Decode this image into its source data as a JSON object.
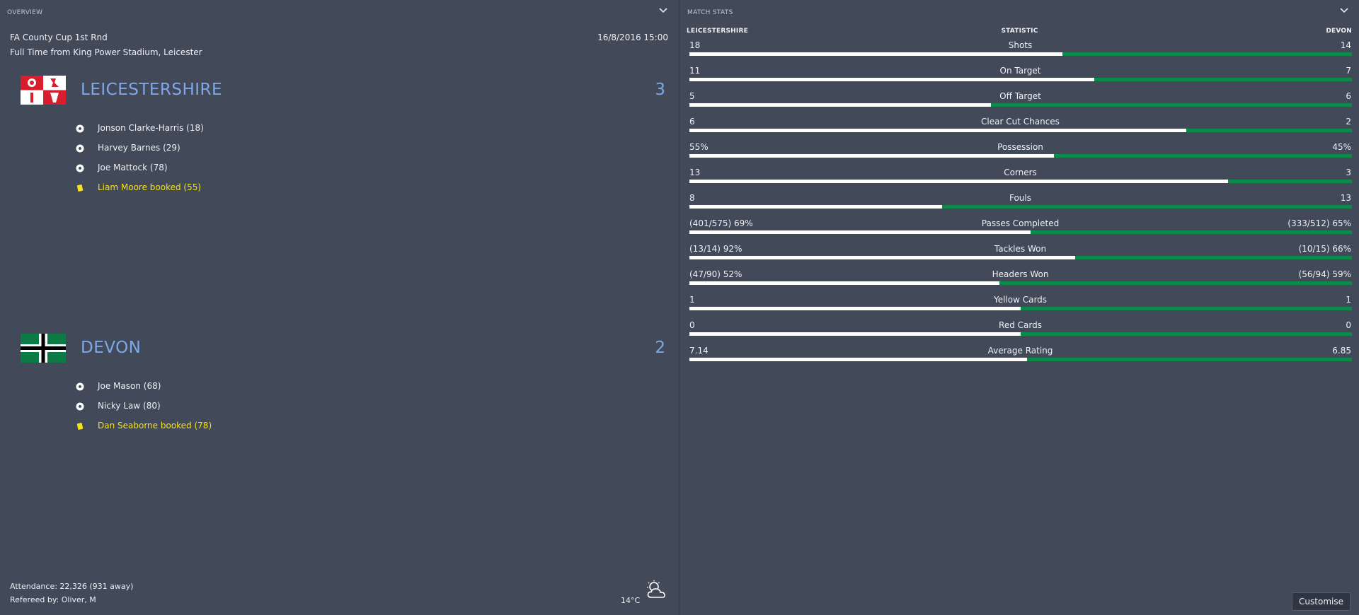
{
  "overview": {
    "panel_title": "OVERVIEW",
    "competition": "FA County Cup 1st Rnd",
    "venue_line": "Full Time from King Power Stadium, Leicester",
    "datetime": "16/8/2016 15:00",
    "home_team": {
      "name": "LEICESTERSHIRE",
      "score": "3",
      "events": [
        {
          "type": "goal",
          "icon": "football-icon",
          "text": "Jonson Clarke-Harris (18)"
        },
        {
          "type": "goal",
          "icon": "football-icon",
          "text": "Harvey Barnes (29)"
        },
        {
          "type": "goal",
          "icon": "football-icon",
          "text": "Joe Mattock (78)"
        },
        {
          "type": "booking",
          "icon": "yellow-card-icon",
          "text": "Liam Moore booked (55)"
        }
      ]
    },
    "away_team": {
      "name": "DEVON",
      "score": "2",
      "events": [
        {
          "type": "goal",
          "icon": "football-icon",
          "text": "Joe Mason (68)"
        },
        {
          "type": "goal",
          "icon": "football-icon",
          "text": "Nicky Law (80)"
        },
        {
          "type": "booking",
          "icon": "yellow-card-icon",
          "text": "Dan Seaborne booked (78)"
        }
      ]
    },
    "attendance": "Attendance: 22,326 (931 away)",
    "referee": "Refereed by: Oliver, M",
    "temperature": "14°C",
    "weather_icon": "partly-cloudy-icon"
  },
  "match_stats": {
    "panel_title": "MATCH STATS",
    "head_left": "LEICESTERSHIRE",
    "head_center": "STATISTIC",
    "head_right": "DEVON",
    "rows": [
      {
        "name": "Shots",
        "home": "18",
        "away": "14",
        "home_share": 0.5625
      },
      {
        "name": "On Target",
        "home": "11",
        "away": "7",
        "home_share": 0.611
      },
      {
        "name": "Off Target",
        "home": "5",
        "away": "6",
        "home_share": 0.455
      },
      {
        "name": "Clear Cut Chances",
        "home": "6",
        "away": "2",
        "home_share": 0.75
      },
      {
        "name": "Possession",
        "home": "55%",
        "away": "45%",
        "home_share": 0.55
      },
      {
        "name": "Corners",
        "home": "13",
        "away": "3",
        "home_share": 0.8125
      },
      {
        "name": "Fouls",
        "home": "8",
        "away": "13",
        "home_share": 0.381
      },
      {
        "name": "Passes Completed",
        "home": "(401/575) 69%",
        "away": "(333/512) 65%",
        "home_share": 0.515
      },
      {
        "name": "Tackles Won",
        "home": "(13/14) 92%",
        "away": "(10/15) 66%",
        "home_share": 0.582
      },
      {
        "name": "Headers Won",
        "home": "(47/90) 52%",
        "away": "(56/94) 59%",
        "home_share": 0.468
      },
      {
        "name": "Yellow Cards",
        "home": "1",
        "away": "1",
        "home_share": 0.5
      },
      {
        "name": "Red Cards",
        "home": "0",
        "away": "0",
        "home_share": 0.5
      },
      {
        "name": "Average Rating",
        "home": "7.14",
        "away": "6.85",
        "home_share": 0.51
      }
    ],
    "customise_label": "Customise"
  },
  "colors": {
    "background": "#424959",
    "team_accent": "#7fa8e6",
    "booking_yellow": "#f4e21a",
    "bar_home": "#ffffff",
    "bar_away": "#0b8a4a"
  }
}
